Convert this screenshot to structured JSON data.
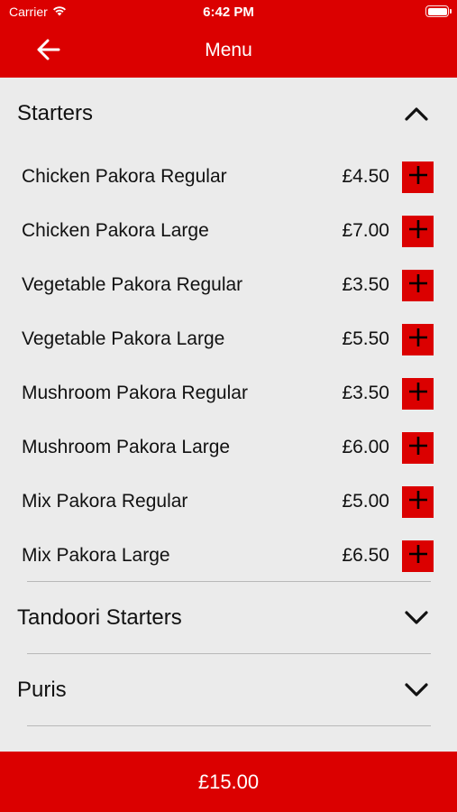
{
  "status_bar": {
    "carrier": "Carrier",
    "time": "6:42 PM"
  },
  "nav": {
    "title": "Menu",
    "back_icon": "arrow-left-icon"
  },
  "sections": [
    {
      "title": "Starters",
      "expanded": true,
      "chevron_icon": "chevron-up-icon",
      "items": [
        {
          "name": "Chicken Pakora Regular",
          "price": "£4.50"
        },
        {
          "name": "Chicken Pakora Large",
          "price": "£7.00"
        },
        {
          "name": "Vegetable Pakora Regular",
          "price": "£3.50"
        },
        {
          "name": "Vegetable Pakora Large",
          "price": "£5.50"
        },
        {
          "name": "Mushroom Pakora Regular",
          "price": "£3.50"
        },
        {
          "name": "Mushroom Pakora Large",
          "price": "£6.00"
        },
        {
          "name": "Mix Pakora Regular",
          "price": "£5.00"
        },
        {
          "name": "Mix Pakora Large",
          "price": "£6.50"
        }
      ]
    },
    {
      "title": "Tandoori Starters",
      "expanded": false,
      "chevron_icon": "chevron-down-icon",
      "items": []
    },
    {
      "title": "Puris",
      "expanded": false,
      "chevron_icon": "chevron-down-icon",
      "items": []
    }
  ],
  "footer": {
    "total": "£15.00"
  },
  "colors": {
    "brand_red": "#db0000",
    "background": "#ebebeb",
    "text": "#111111",
    "divider": "#b8b8b8"
  }
}
